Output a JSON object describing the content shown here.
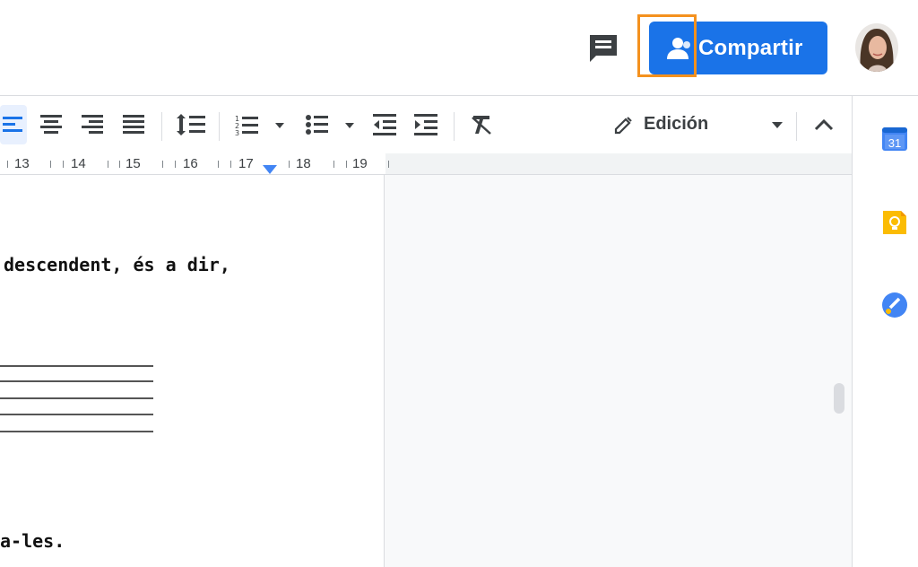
{
  "header": {
    "share_label": "Compartir",
    "share_icon": "person-add-icon",
    "comment_icon": "comment-icon",
    "avatar_icon": "user-avatar",
    "accent_color": "#1a73e8",
    "highlight_color": "#f4911e"
  },
  "toolbar": {
    "mode_label": "Edición",
    "icons": [
      "align-left-icon",
      "align-center-icon",
      "align-right-icon",
      "align-justify-icon",
      "line-spacing-icon",
      "numbered-list-icon",
      "bulleted-list-icon",
      "decrease-indent-icon",
      "increase-indent-icon",
      "clear-formatting-icon",
      "pencil-icon",
      "collapse-icon"
    ]
  },
  "ruler": {
    "marks": [
      "13",
      "14",
      "15",
      "16",
      "17",
      "18",
      "19"
    ]
  },
  "document": {
    "line1": "descendent, és a dir,",
    "line2": "a-les."
  },
  "side_panel": {
    "calendar_day": "31",
    "icons": [
      "calendar-icon",
      "keep-icon",
      "tasks-icon"
    ]
  }
}
